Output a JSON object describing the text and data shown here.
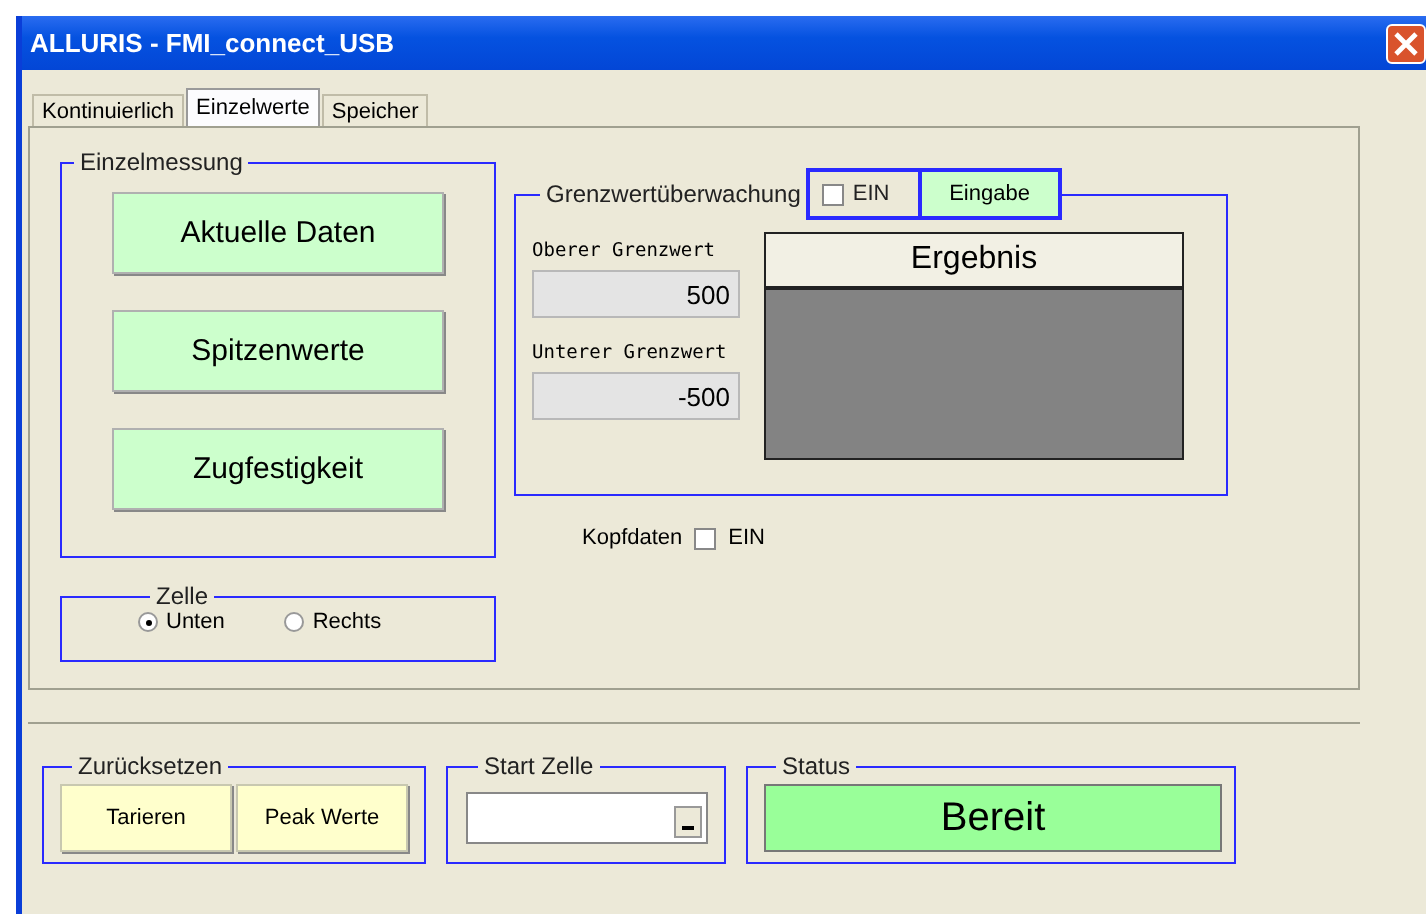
{
  "window": {
    "title": "ALLURIS - FMI_connect_USB"
  },
  "tabs": [
    {
      "label": "Kontinuierlich",
      "selected": false
    },
    {
      "label": "Einzelwerte",
      "selected": true
    },
    {
      "label": "Speicher",
      "selected": false
    }
  ],
  "einzelmessung": {
    "title": "Einzelmessung",
    "buttons": [
      "Aktuelle Daten",
      "Spitzenwerte",
      "Zugfestigkeit"
    ]
  },
  "zelle": {
    "title": "Zelle",
    "options": [
      {
        "label": "Unten",
        "selected": true
      },
      {
        "label": "Rechts",
        "selected": false
      }
    ]
  },
  "grenzwert": {
    "title": "Grenzwertüberwachung",
    "enable": {
      "label": "EIN",
      "checked": false
    },
    "input_button": "Eingabe",
    "upper": {
      "label": "Oberer Grenzwert",
      "value": "500"
    },
    "lower": {
      "label": "Unterer Grenzwert",
      "value": "-500"
    },
    "result": {
      "title": "Ergebnis"
    }
  },
  "kopfdaten": {
    "label": "Kopfdaten",
    "checkbox": {
      "label": "EIN",
      "checked": false
    }
  },
  "reset": {
    "title": "Zurücksetzen",
    "buttons": [
      "Tarieren",
      "Peak Werte"
    ]
  },
  "start_cell": {
    "title": "Start Zelle"
  },
  "status": {
    "title": "Status",
    "value": "Bereit"
  }
}
